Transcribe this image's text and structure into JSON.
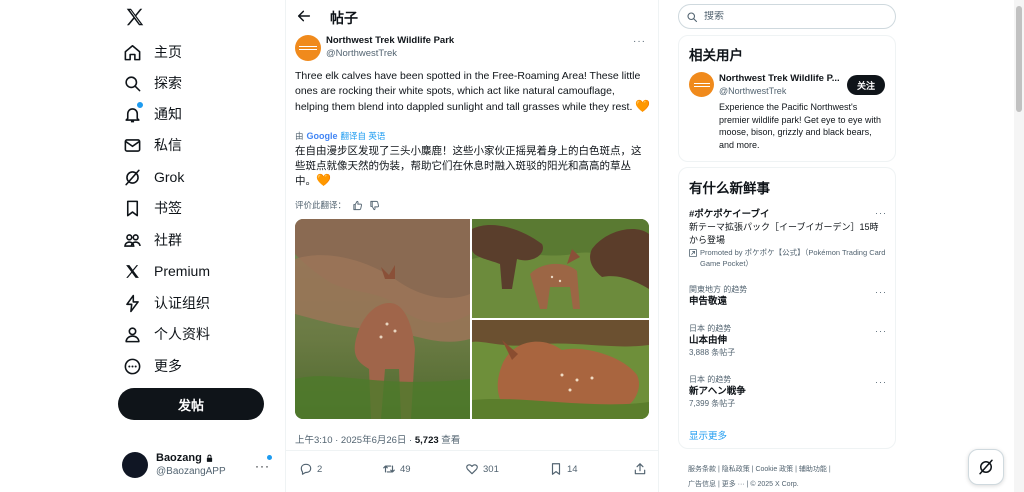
{
  "nav": {
    "items": [
      {
        "label": "主页",
        "icon": "home-icon"
      },
      {
        "label": "探索",
        "icon": "search-icon"
      },
      {
        "label": "通知",
        "icon": "bell-icon"
      },
      {
        "label": "私信",
        "icon": "mail-icon"
      },
      {
        "label": "Grok",
        "icon": "grok-icon"
      },
      {
        "label": "书签",
        "icon": "bookmark-icon"
      },
      {
        "label": "社群",
        "icon": "communities-icon"
      },
      {
        "label": "Premium",
        "icon": "x-premium-icon"
      },
      {
        "label": "认证组织",
        "icon": "lightning-icon"
      },
      {
        "label": "个人资料",
        "icon": "person-icon"
      },
      {
        "label": "更多",
        "icon": "more-circle-icon"
      }
    ],
    "post_button": "发帖",
    "account": {
      "name": "Baozang",
      "handle": "@BaozangAPP"
    }
  },
  "header": {
    "title": "帖子"
  },
  "post": {
    "author": {
      "name": "Northwest Trek Wildlife Park",
      "handle": "@NorthwestTrek"
    },
    "text": "Three elk calves have been spotted in the Free-Roaming Area! These little ones are rocking their white spots, which act like natural camouflage, helping them blend into dappled sunlight and tall grasses while they rest.",
    "translated_by_prefix": "由",
    "translated_by_brand": "Google",
    "translated_from": "翻译自 英语",
    "translation": "在自由漫步区发现了三头小麋鹿！这些小家伙正摇晃着身上的白色斑点，这些斑点就像天然的伪装，帮助它们在休息时融入斑驳的阳光和高高的草丛中。",
    "rate_label": "评价此翻译：",
    "time": "上午3:10 · 2025年6月26日 · ",
    "views": "5,723",
    "views_label": " 查看",
    "stats": {
      "replies": "2",
      "reposts": "49",
      "likes": "301",
      "bookmarks": "14"
    }
  },
  "search": {
    "placeholder": "搜索"
  },
  "related": {
    "title": "相关用户",
    "user": {
      "name": "Northwest Trek Wildlife P...",
      "handle": "@NorthwestTrek",
      "bio": "Experience the Pacific Northwest's premier wildlife park! Get eye to eye with moose, bison, grizzly and black bears, and more.",
      "follow": "关注"
    }
  },
  "trends": {
    "title": "有什么新鲜事",
    "items": [
      {
        "name": "#ポケポケイーブイ",
        "desc": "新テーマ拡張パック［イーブイガーデン］15時から登場",
        "promo": "Promoted by ポケポケ【公式】（Pokémon Trading Card Game Pocket）"
      },
      {
        "context": "関東地方 的趋势",
        "name": "申告敬遠"
      },
      {
        "context": "日本 的趋势",
        "name": "山本由伸",
        "count": "3,888 条帖子"
      },
      {
        "context": "日本 的趋势",
        "name": "新アヘン戦争",
        "count": "7,399 条帖子"
      }
    ],
    "show_more": "显示更多"
  },
  "footer": {
    "links": [
      "服务条款",
      "隐私政策",
      "Cookie 政策",
      "辅助功能",
      "广告信息",
      "更多 ···"
    ],
    "copyright": "© 2025 X Corp."
  },
  "colors": {
    "accent": "#1d9bf0",
    "brand_orange": "#f08a1c",
    "text": "#0f1419",
    "muted": "#536471"
  }
}
